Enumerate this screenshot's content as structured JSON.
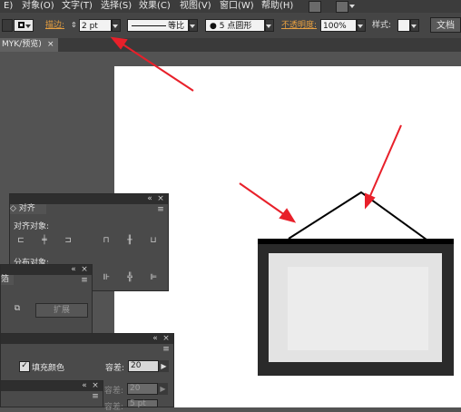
{
  "menu": {
    "items": [
      "E)",
      "对象(O)",
      "文字(T)",
      "选择(S)",
      "效果(C)",
      "视图(V)",
      "窗口(W)",
      "帮助(H)"
    ],
    "icons": [
      "bridge-icon",
      "arrange-icon"
    ]
  },
  "control_bar": {
    "stroke_label": "描边:",
    "stroke_weight": "2 pt",
    "stroke_profile": "等比",
    "brush": "5 点圆形",
    "opacity_label": "不透明度:",
    "opacity_value": "100%",
    "style_label": "样式:",
    "doc_setup": "文档"
  },
  "document_tab": {
    "title": "MYK/预览)",
    "close": "×"
  },
  "align_panel": {
    "tab": "◇ 对齐",
    "align_objects_label": "对齐对象:",
    "distribute_objects_label": "分布对象:"
  },
  "pathfinder_panel": {
    "tab": "箔",
    "expand_button": "扩展"
  },
  "fill_panel": {
    "fill_color_label": "填充颜色",
    "fill_checked": true,
    "tolerance_label": "容差:",
    "tolerance_value": "20",
    "tolerance2_label": "容差:",
    "tolerance2_value": "20",
    "tolerance3_label": "容差:",
    "tolerance3_value": "5 pt"
  },
  "colors": {
    "annotation_arrow": "#e8202a",
    "opacity_label": "#e8a040"
  }
}
